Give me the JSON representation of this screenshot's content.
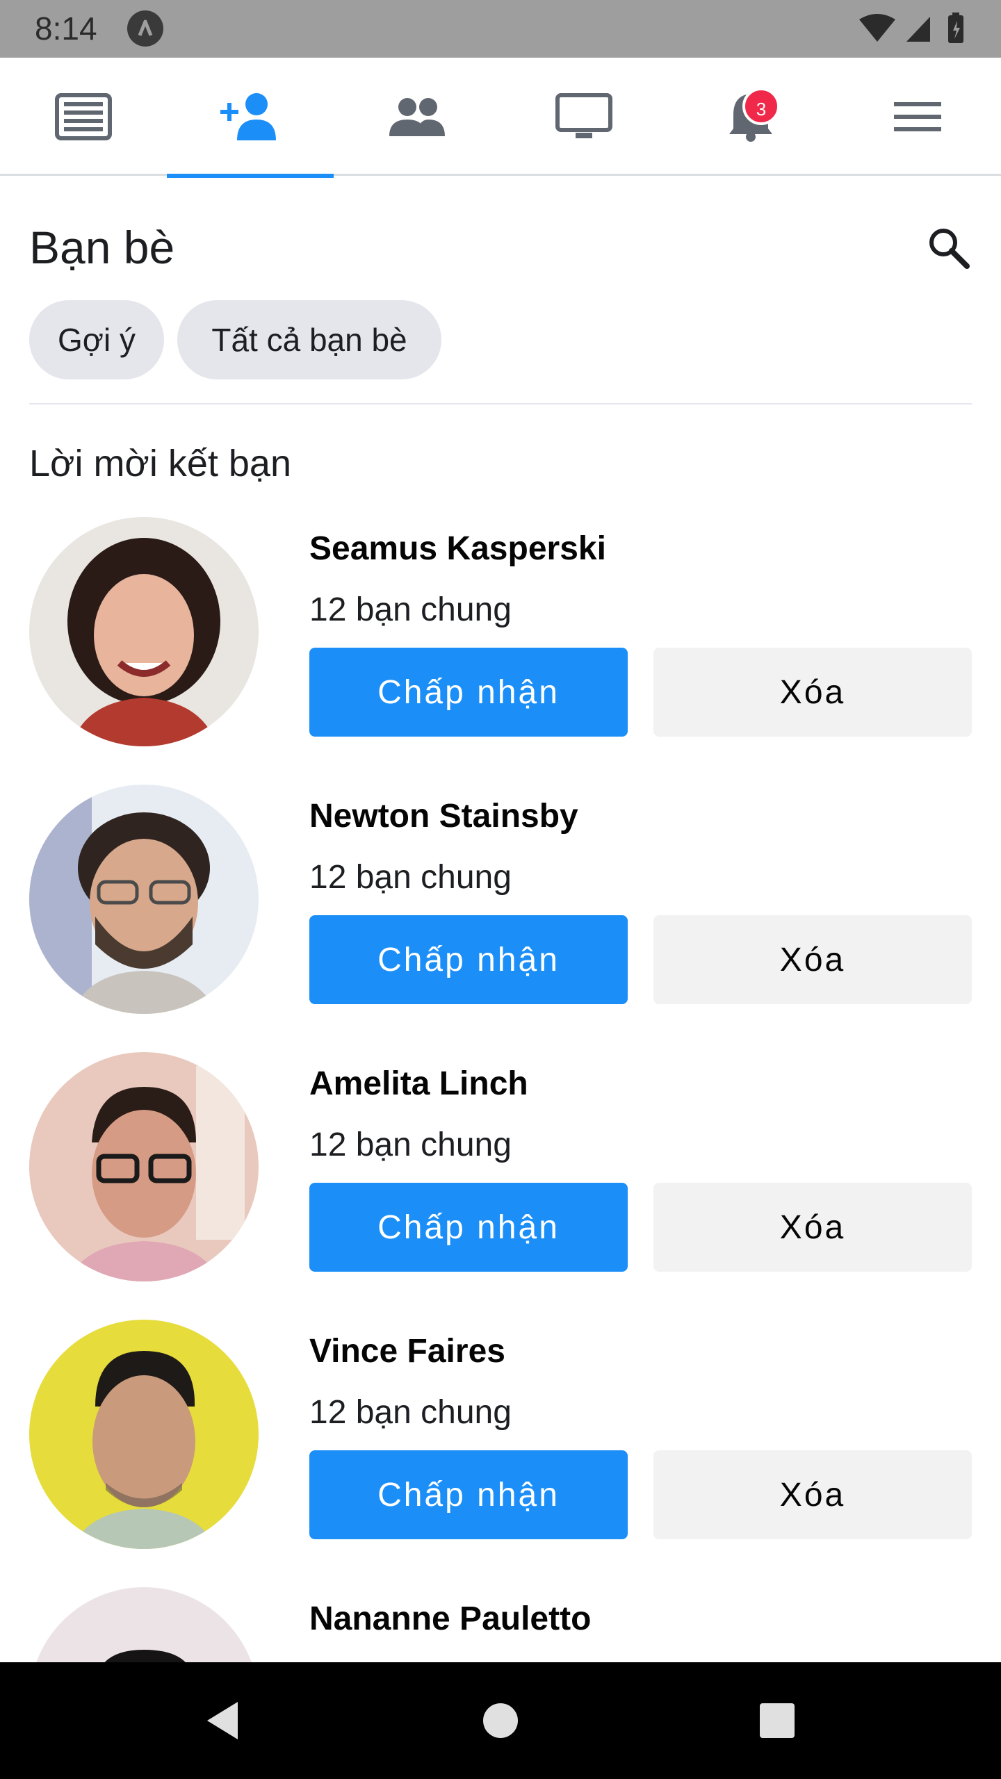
{
  "status_bar": {
    "time": "8:14",
    "icons": [
      "app-a-icon",
      "wifi-icon",
      "signal-icon",
      "battery-icon"
    ]
  },
  "tabs": [
    {
      "name": "news-feed",
      "icon": "newspaper-icon"
    },
    {
      "name": "friends",
      "icon": "add-friend-icon",
      "active": true
    },
    {
      "name": "groups",
      "icon": "group-icon"
    },
    {
      "name": "watch",
      "icon": "tv-icon"
    },
    {
      "name": "notifications",
      "icon": "bell-icon",
      "badge": "3"
    },
    {
      "name": "menu",
      "icon": "hamburger-icon"
    }
  ],
  "header": {
    "title": "Bạn bè",
    "search_icon": "search-icon"
  },
  "chips": [
    "Gợi ý",
    "Tất cả bạn bè"
  ],
  "section_title": "Lời mời kết bạn",
  "requests": [
    {
      "name": "Seamus Kasperski",
      "mutual": "12 bạn chung",
      "accept": "Chấp nhận",
      "delete": "Xóa"
    },
    {
      "name": "Newton Stainsby",
      "mutual": "12 bạn chung",
      "accept": "Chấp nhận",
      "delete": "Xóa"
    },
    {
      "name": "Amelita Linch",
      "mutual": "12 bạn chung",
      "accept": "Chấp nhận",
      "delete": "Xóa"
    },
    {
      "name": "Vince Faires",
      "mutual": "12 bạn chung",
      "accept": "Chấp nhận",
      "delete": "Xóa"
    },
    {
      "name": "Nananne Pauletto"
    }
  ],
  "nav": [
    "back-icon",
    "home-icon",
    "recents-icon"
  ],
  "colors": {
    "accent": "#1b8ff7",
    "badge": "#f02849",
    "chip_bg": "#e4e6eb",
    "delete_bg": "#f2f2f2"
  }
}
